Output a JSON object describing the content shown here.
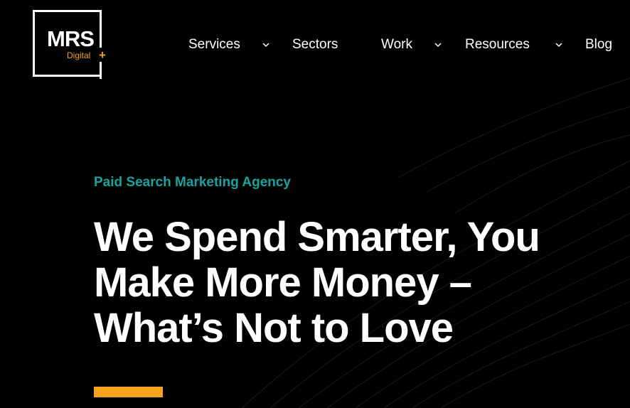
{
  "brand": {
    "logo_main": "MRS",
    "logo_sub": "Digital",
    "logo_plus": "+",
    "accent_color": "#f7a21b",
    "teal_color": "#1aa39d",
    "background_color": "#000000"
  },
  "nav": {
    "items": [
      {
        "label": "Services",
        "has_dropdown": true
      },
      {
        "label": "Sectors",
        "has_dropdown": false
      },
      {
        "label": "Work",
        "has_dropdown": true
      },
      {
        "label": "Resources",
        "has_dropdown": true
      },
      {
        "label": "Blog",
        "has_dropdown": false
      }
    ],
    "chevron_icon": "chevron-down-icon"
  },
  "hero": {
    "eyebrow": "Paid Search Marketing Agency",
    "headline_line1": "We Spend Smarter, You",
    "headline_line2": "Make More Money –",
    "headline_line3": "What’s Not to Love"
  }
}
